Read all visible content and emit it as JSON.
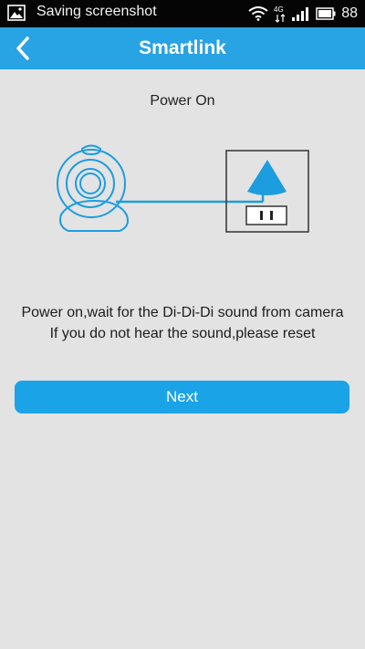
{
  "status_bar": {
    "notification_text": "Saving screenshot",
    "battery_level": "88",
    "icons": [
      "image-icon",
      "wifi-icon",
      "4g-icon",
      "signal-icon",
      "battery-icon"
    ]
  },
  "header": {
    "title": "Smartlink",
    "back_icon": "chevron-left-icon"
  },
  "main": {
    "step_title": "Power On",
    "illustration": "camera-power-plug-illustration",
    "instructions": [
      "Power on,wait for the Di-Di-Di sound from camera",
      "If you do not hear the sound,please reset"
    ],
    "next_label": "Next"
  },
  "colors": {
    "accent": "#28a3e4",
    "button": "#1ba3e8",
    "background": "#e3e3e3",
    "status_bar": "#050505",
    "illustration_line": "#1c9de0"
  }
}
